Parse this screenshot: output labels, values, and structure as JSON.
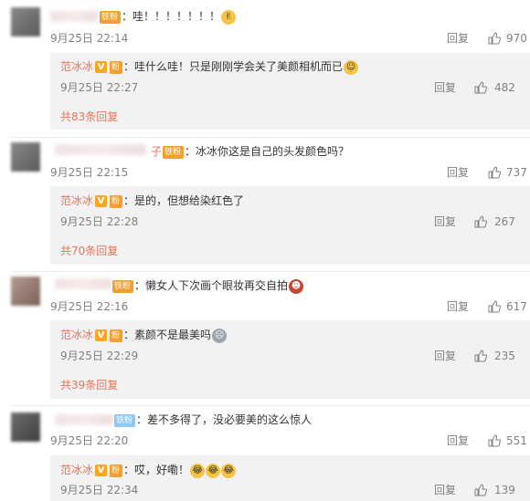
{
  "comments": [
    {
      "badge": "铁粉",
      "text": "：哇！！！！！！！",
      "date": "9月25日 22:14",
      "reply": "回复",
      "likes": "970",
      "sub": {
        "name": "范冰冰",
        "text": "：哇什么哇！只是刚刚学会关了美颜相机而已",
        "date": "9月25日 22:27",
        "reply": "回复",
        "likes": "482"
      },
      "more": "共83条回复"
    },
    {
      "name_tail": "子",
      "badge": "铁粉",
      "text": "：冰冰你这是自己的头发颜色吗？",
      "date": "9月25日 22:15",
      "reply": "回复",
      "likes": "737",
      "sub": {
        "name": "范冰冰",
        "text": "：是的，但想给染红色了",
        "date": "9月25日 22:28",
        "reply": "回复",
        "likes": "267"
      },
      "more": "共70条回复"
    },
    {
      "badge": "铁粉",
      "text": "：懒女人下次画个眼妆再交自拍",
      "date": "9月25日 22:16",
      "reply": "回复",
      "likes": "617",
      "sub": {
        "name": "范冰冰",
        "text": "：素颜不是最美吗",
        "date": "9月25日 22:29",
        "reply": "回复",
        "likes": "235"
      },
      "more": "共39条回复"
    },
    {
      "badge": "铁粉",
      "text": "：差不多得了，没必要美的这么惊人",
      "date": "9月25日 22:20",
      "reply": "回复",
      "likes": "551",
      "sub": {
        "name": "范冰冰",
        "text": "：哎，好嘞！",
        "date": "9月25日 22:34",
        "reply": "回复",
        "likes": "139"
      }
    }
  ],
  "colors": {
    "name": "#eb7350",
    "meta": "#808080",
    "subbg": "#f2f2f5"
  },
  "icons": {
    "like": "thumbs-up-icon",
    "verified": "v-verified-icon",
    "fan": "fan-badge-icon"
  }
}
